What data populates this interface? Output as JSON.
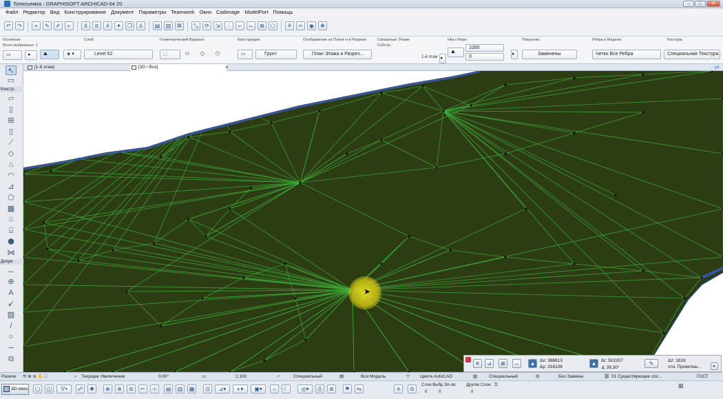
{
  "window": {
    "title": "Топосьемка - GRAPHISOFT ARCHICAD-64 20",
    "min": "–",
    "max": "□",
    "close": "✕"
  },
  "menu": [
    "Файл",
    "Редактор",
    "Вид",
    "Конструирование",
    "Документ",
    "Параметры",
    "Teamwork",
    "Окно",
    "Cadimage",
    "ModelPort",
    "Помощь"
  ],
  "infobox": {
    "main_label": "Основная:",
    "all_selected": "Всего выбранных: 1",
    "layer_label": "Слой:",
    "layer_value": "Level 62",
    "geometry_label": "Геометрический Вариант:",
    "structure_label": "Конструкция:",
    "structure_value": "Грунт",
    "display_label": "Отображение на Плане и в Разрезе:",
    "display_value": "План Этажа и Разрез...",
    "linked_label": "Связанные Этажи:",
    "own_label": "Собств.:",
    "floor_ref": "1-й этаж",
    "base_label": "Низ к Верх:",
    "top_value": "1000",
    "bottom_value": "0",
    "surface_label": "Покрытие:",
    "surface_value": "Заменены",
    "edges_label": "Ребра в Модели:",
    "edges_value": "Четко Все Ребра",
    "texture_label": "Текстура",
    "texture_value": "Специальная Текстура"
  },
  "tabs": [
    {
      "label": "[1-й этаж]"
    },
    {
      "label": "[3D / Все]"
    }
  ],
  "tab_close": "×",
  "toolbox": {
    "section_design": "Констр",
    "section_document": "Докум"
  },
  "coords": {
    "ax": "Δx: 388613",
    "ay": "Δy: 318106",
    "ar": "Δr: 502207",
    "angle": "∡ 39,30°",
    "az": "Δz: 1819",
    "ref": "отн. Проектны..."
  },
  "quick_options": {
    "palette": "Разное",
    "zoom": "Текущее Увеличение",
    "angle": "0,00°",
    "scale": "1:100",
    "special": "Специальный",
    "model": "Вся Модель",
    "colors": "Цвета AutoCAD",
    "special2": "Специальный",
    "no_override": "Без Замены",
    "renovation": "01 Существующее сос...",
    "standard": "ГОСТ"
  },
  "bottombar": {
    "window_3d": "3D-окно",
    "layers_sel": "Слои Выбр.Эл-ов:",
    "other_layers": "Другие Слои:",
    "val0a": "0",
    "val0b": "0",
    "val0c": "0"
  },
  "colors": {
    "terrain_fill": "#2c3d14",
    "mesh_edge": "#3fae3a",
    "boundary": "#3a55a0",
    "highlight": "#e2d52a"
  }
}
